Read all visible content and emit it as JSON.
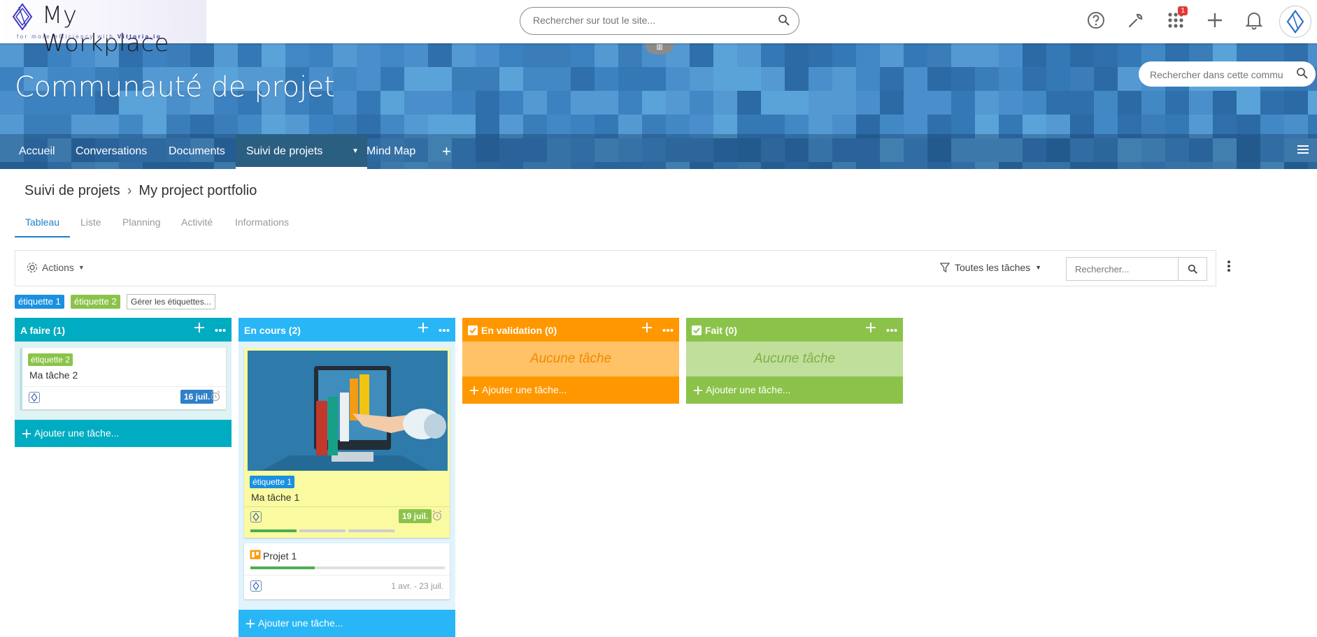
{
  "brand": {
    "title": "My Workplace",
    "tagline_prefix": "for more efficiency with ",
    "tagline_brand": "Vittoria.io"
  },
  "global_search": {
    "placeholder": "Rechercher sur tout le site..."
  },
  "topbar": {
    "apps_badge": "1"
  },
  "community": {
    "title": "Communauté de projet",
    "search_placeholder": "Rechercher dans cette commu"
  },
  "nav": {
    "items": [
      {
        "label": "Accueil"
      },
      {
        "label": "Conversations"
      },
      {
        "label": "Documents"
      },
      {
        "label": "Suivi de projets"
      },
      {
        "label": "Mind Map"
      }
    ]
  },
  "breadcrumb": {
    "parent": "Suivi de projets",
    "current": "My project portfolio"
  },
  "subtabs": [
    {
      "label": "Tableau"
    },
    {
      "label": "Liste"
    },
    {
      "label": "Planning"
    },
    {
      "label": "Activité"
    },
    {
      "label": "Informations"
    }
  ],
  "toolbar": {
    "actions_label": "Actions",
    "filter_label": "Toutes les tâches",
    "search_placeholder": "Rechercher..."
  },
  "tags": {
    "tag1": "étiquette 1",
    "tag2": "étiquette 2",
    "manage": "Gérer les étiquettes..."
  },
  "columns": [
    {
      "title": "A faire (1)",
      "add_label": "Ajouter une tâche...",
      "color": "#00acc1"
    },
    {
      "title": "En cours (2)",
      "add_label": "Ajouter une tâche...",
      "color": "#29b6f6"
    },
    {
      "title": "En validation (0)",
      "add_label": "Ajouter une tâche...",
      "empty": "Aucune tâche",
      "color": "#ff9800"
    },
    {
      "title": "Fait (0)",
      "add_label": "Ajouter une tâche...",
      "empty": "Aucune tâche",
      "color": "#8bc34a"
    }
  ],
  "cards": {
    "task2": {
      "tag": "étiquette 2",
      "title": "Ma tâche 2",
      "date": "16 juil."
    },
    "task1": {
      "tag": "étiquette 1",
      "title": "Ma tâche 1",
      "date": "19 juil."
    },
    "project1": {
      "title": "Projet 1",
      "dates": "1 avr. - 23 juil.",
      "progress": 0.33
    }
  },
  "colors": {
    "accent": "#1f7fc6",
    "nav_active": "#2b5f82",
    "teal": "#00acc1",
    "sky": "#29b6f6",
    "orange": "#ff9800",
    "green": "#8bc34a",
    "yellow_card": "#fafaa0",
    "date_blue": "#2f80c8",
    "date_green": "#8bc34a"
  }
}
